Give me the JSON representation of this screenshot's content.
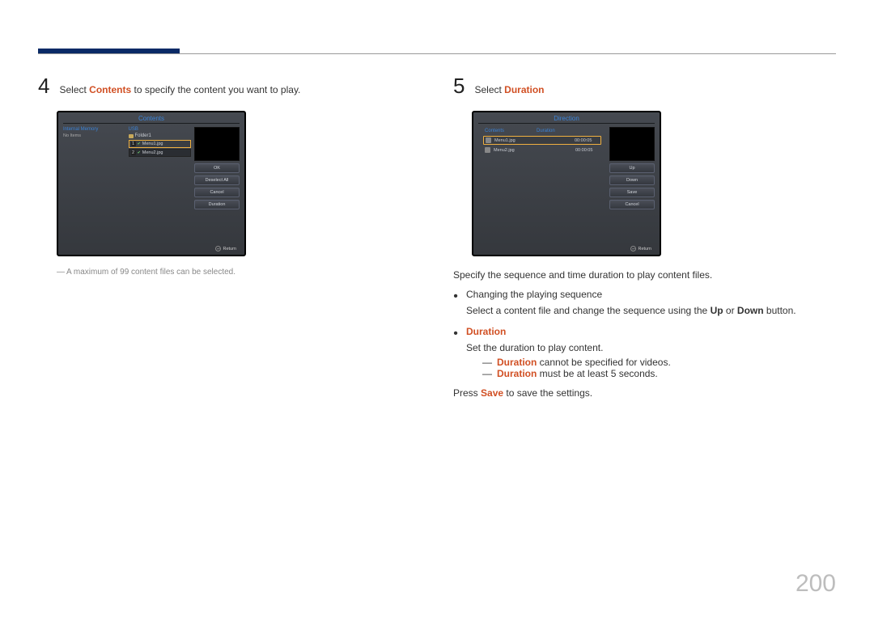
{
  "page_number": "200",
  "step4": {
    "num": "4",
    "text_pre": "Select ",
    "text_hl": "Contents",
    "text_post": " to specify the content you want to play.",
    "note_pre": "A maximum of 99 content files can be selected.",
    "mock": {
      "title": "Contents",
      "left_hdr": "Internal Memory",
      "right_hdr": "USB",
      "no_items": "No Items",
      "folder": "Folder1",
      "row1_num": "1",
      "row1_file": "Menu1.jpg",
      "row2_num": "2",
      "row2_file": "Menu2.jpg",
      "btn_ok": "OK",
      "btn_deselect": "Deselect All",
      "btn_cancel": "Cancel",
      "btn_duration": "Duration",
      "return": "Return"
    }
  },
  "step5": {
    "num": "5",
    "text_pre": "Select ",
    "text_hl": "Duration",
    "mock": {
      "title": "Direction",
      "tab1": "Contents",
      "tab2": "Duration",
      "row1_file": "Menu1.jpg",
      "row1_dur": "00:00:05",
      "row2_file": "Menu2.jpg",
      "row2_dur": "00:00:05",
      "btn_up": "Up",
      "btn_down": "Down",
      "btn_save": "Save",
      "btn_cancel": "Cancel",
      "return": "Return"
    },
    "desc1": "Specify the sequence and time duration to play content files.",
    "b1_title": "Changing the playing sequence",
    "b1_line_pre": "Select a content file and change the sequence using the ",
    "b1_up": "Up",
    "b1_or": " or ",
    "b1_down": "Down",
    "b1_post": " button.",
    "b2_title": "Duration",
    "b2_line": "Set the duration to play content.",
    "b2_n1_hl": "Duration",
    "b2_n1_post": " cannot be specified for videos.",
    "b2_n2_hl": "Duration",
    "b2_n2_post": " must be at least 5 seconds.",
    "press_pre": "Press ",
    "press_hl": "Save",
    "press_post": " to save the settings."
  }
}
